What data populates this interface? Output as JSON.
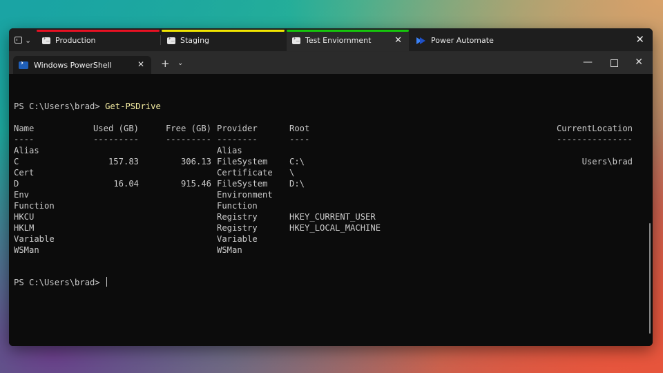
{
  "outer_tabs": [
    {
      "label": "Production",
      "color": "#e81123"
    },
    {
      "label": "Staging",
      "color": "#f2e600"
    },
    {
      "label": "Test Enviornment",
      "color": "#16c60c"
    },
    {
      "label": "Power Automate"
    }
  ],
  "inner_tab": {
    "label": "Windows PowerShell"
  },
  "prompt": "PS C:\\Users\\brad>",
  "command": "Get-PSDrive",
  "headers": {
    "name": "Name",
    "used": "Used (GB)",
    "free": "Free (GB)",
    "provider": "Provider",
    "root": "Root",
    "location": "CurrentLocation"
  },
  "underlines": {
    "name": "----",
    "used": "---------",
    "free": "---------",
    "provider": "--------",
    "root": "----",
    "location": "---------------"
  },
  "rows": [
    {
      "name": "Alias",
      "used": "",
      "free": "",
      "provider": "Alias",
      "root": "",
      "location": ""
    },
    {
      "name": "C",
      "used": "157.83",
      "free": "306.13",
      "provider": "FileSystem",
      "root": "C:\\",
      "location": "Users\\brad"
    },
    {
      "name": "Cert",
      "used": "",
      "free": "",
      "provider": "Certificate",
      "root": "\\",
      "location": ""
    },
    {
      "name": "D",
      "used": "16.04",
      "free": "915.46",
      "provider": "FileSystem",
      "root": "D:\\",
      "location": ""
    },
    {
      "name": "Env",
      "used": "",
      "free": "",
      "provider": "Environment",
      "root": "",
      "location": ""
    },
    {
      "name": "Function",
      "used": "",
      "free": "",
      "provider": "Function",
      "root": "",
      "location": ""
    },
    {
      "name": "HKCU",
      "used": "",
      "free": "",
      "provider": "Registry",
      "root": "HKEY_CURRENT_USER",
      "location": ""
    },
    {
      "name": "HKLM",
      "used": "",
      "free": "",
      "provider": "Registry",
      "root": "HKEY_LOCAL_MACHINE",
      "location": ""
    },
    {
      "name": "Variable",
      "used": "",
      "free": "",
      "provider": "Variable",
      "root": "",
      "location": ""
    },
    {
      "name": "WSMan",
      "used": "",
      "free": "",
      "provider": "WSMan",
      "root": "",
      "location": ""
    }
  ]
}
